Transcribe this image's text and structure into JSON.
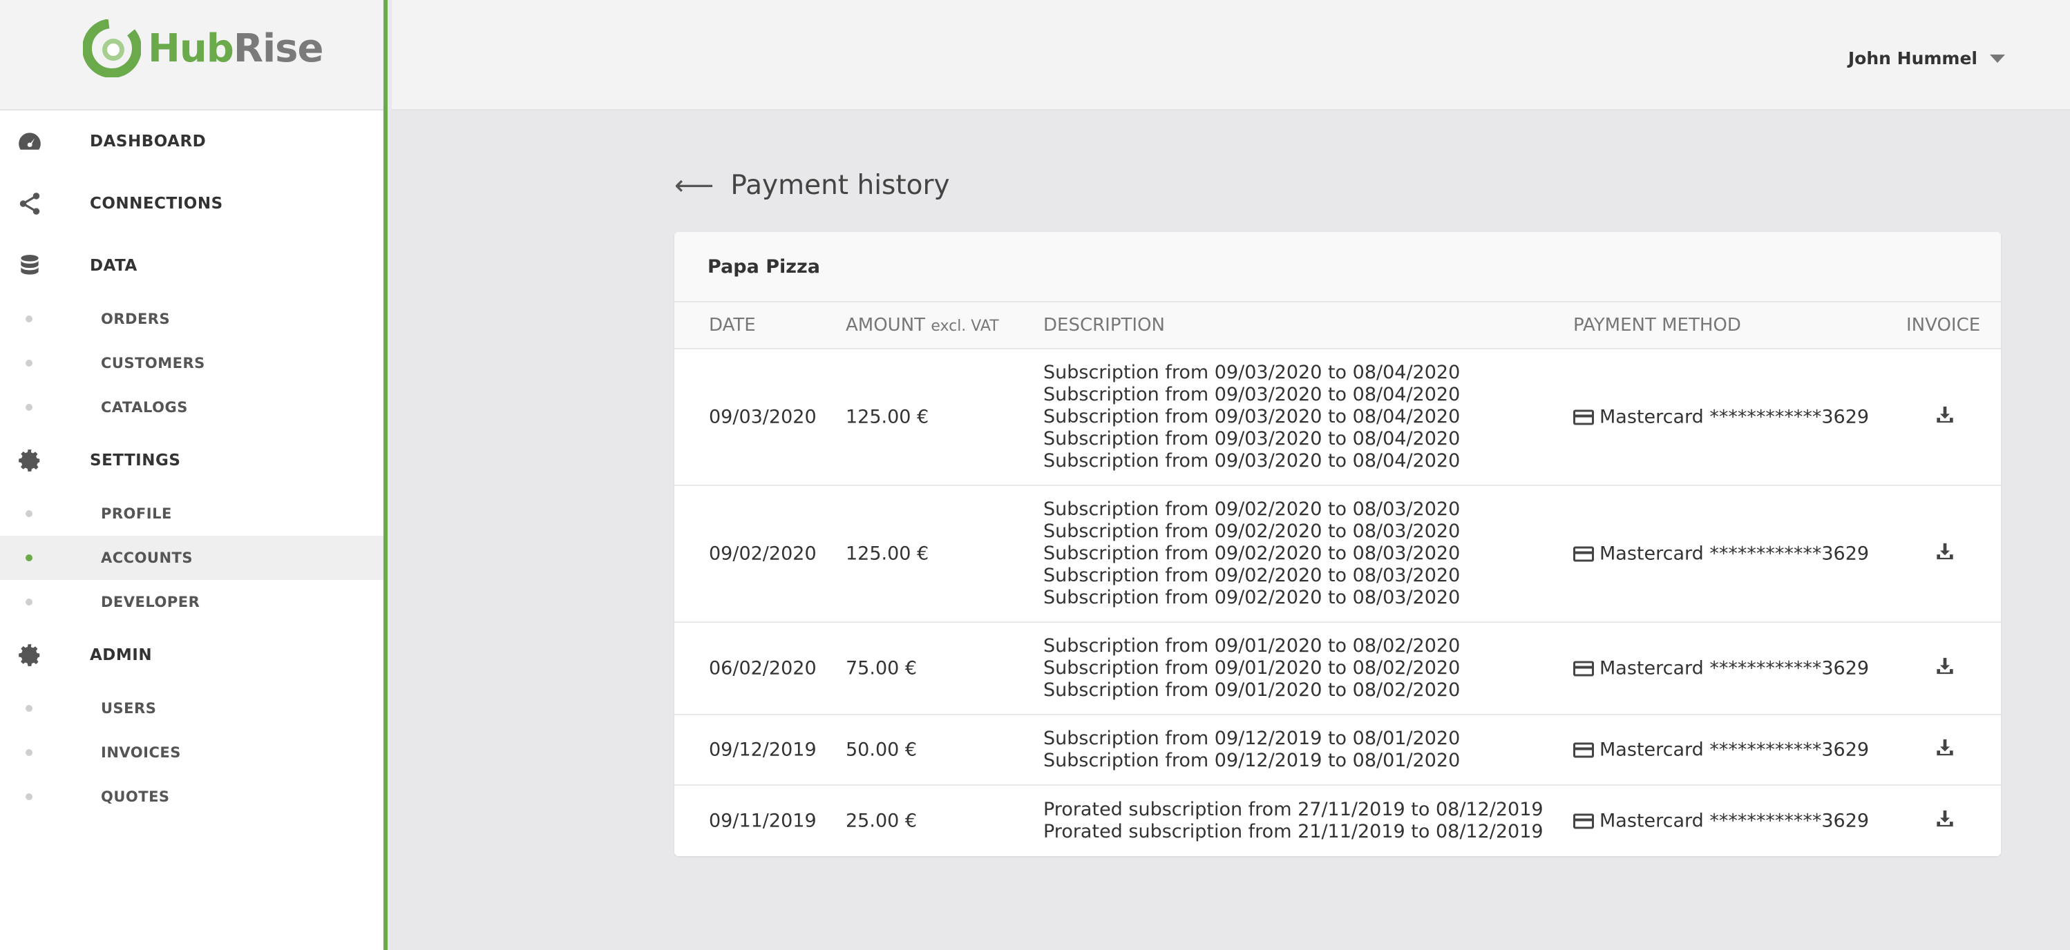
{
  "brand": {
    "name_part1": "Hub",
    "name_part2": "Rise"
  },
  "user": {
    "name": "John Hummel"
  },
  "sidebar": {
    "items": [
      {
        "label": "DASHBOARD",
        "icon": "dashboard-icon",
        "type": "top"
      },
      {
        "label": "CONNECTIONS",
        "icon": "share-icon",
        "type": "top"
      },
      {
        "label": "DATA",
        "icon": "database-icon",
        "type": "top"
      },
      {
        "label": "ORDERS",
        "type": "sub"
      },
      {
        "label": "CUSTOMERS",
        "type": "sub"
      },
      {
        "label": "CATALOGS",
        "type": "sub"
      },
      {
        "label": "SETTINGS",
        "icon": "gear-icon",
        "type": "top"
      },
      {
        "label": "PROFILE",
        "type": "sub"
      },
      {
        "label": "ACCOUNTS",
        "type": "sub",
        "active": true
      },
      {
        "label": "DEVELOPER",
        "type": "sub"
      },
      {
        "label": "ADMIN",
        "icon": "gear-icon",
        "type": "top"
      },
      {
        "label": "USERS",
        "type": "sub"
      },
      {
        "label": "INVOICES",
        "type": "sub"
      },
      {
        "label": "QUOTES",
        "type": "sub"
      }
    ]
  },
  "page": {
    "back_icon": "arrow-left-icon",
    "title": "Payment history"
  },
  "card": {
    "account_name": "Papa Pizza",
    "columns": {
      "date": "DATE",
      "amount": "AMOUNT",
      "amount_note": "excl. VAT",
      "description": "DESCRIPTION",
      "payment_method": "PAYMENT METHOD",
      "invoice": "INVOICE"
    },
    "rows": [
      {
        "date": "09/03/2020",
        "amount": "125.00 €",
        "description": [
          "Subscription from 09/03/2020 to 08/04/2020",
          "Subscription from 09/03/2020 to 08/04/2020",
          "Subscription from 09/03/2020 to 08/04/2020",
          "Subscription from 09/03/2020 to 08/04/2020",
          "Subscription from 09/03/2020 to 08/04/2020"
        ],
        "payment_method": "Mastercard ************3629"
      },
      {
        "date": "09/02/2020",
        "amount": "125.00 €",
        "description": [
          "Subscription from 09/02/2020 to 08/03/2020",
          "Subscription from 09/02/2020 to 08/03/2020",
          "Subscription from 09/02/2020 to 08/03/2020",
          "Subscription from 09/02/2020 to 08/03/2020",
          "Subscription from 09/02/2020 to 08/03/2020"
        ],
        "payment_method": "Mastercard ************3629"
      },
      {
        "date": "06/02/2020",
        "amount": "75.00 €",
        "description": [
          "Subscription from 09/01/2020 to 08/02/2020",
          "Subscription from 09/01/2020 to 08/02/2020",
          "Subscription from 09/01/2020 to 08/02/2020"
        ],
        "payment_method": "Mastercard ************3629"
      },
      {
        "date": "09/12/2019",
        "amount": "50.00 €",
        "description": [
          "Subscription from 09/12/2019 to 08/01/2020",
          "Subscription from 09/12/2019 to 08/01/2020"
        ],
        "payment_method": "Mastercard ************3629"
      },
      {
        "date": "09/11/2019",
        "amount": "25.00 €",
        "description": [
          "Prorated subscription from 27/11/2019 to 08/12/2019",
          "Prorated subscription from 21/11/2019 to 08/12/2019"
        ],
        "payment_method": "Mastercard ************3629"
      }
    ]
  },
  "colors": {
    "accent": "#6aaa4b",
    "text": "#333333",
    "muted": "#777777"
  }
}
